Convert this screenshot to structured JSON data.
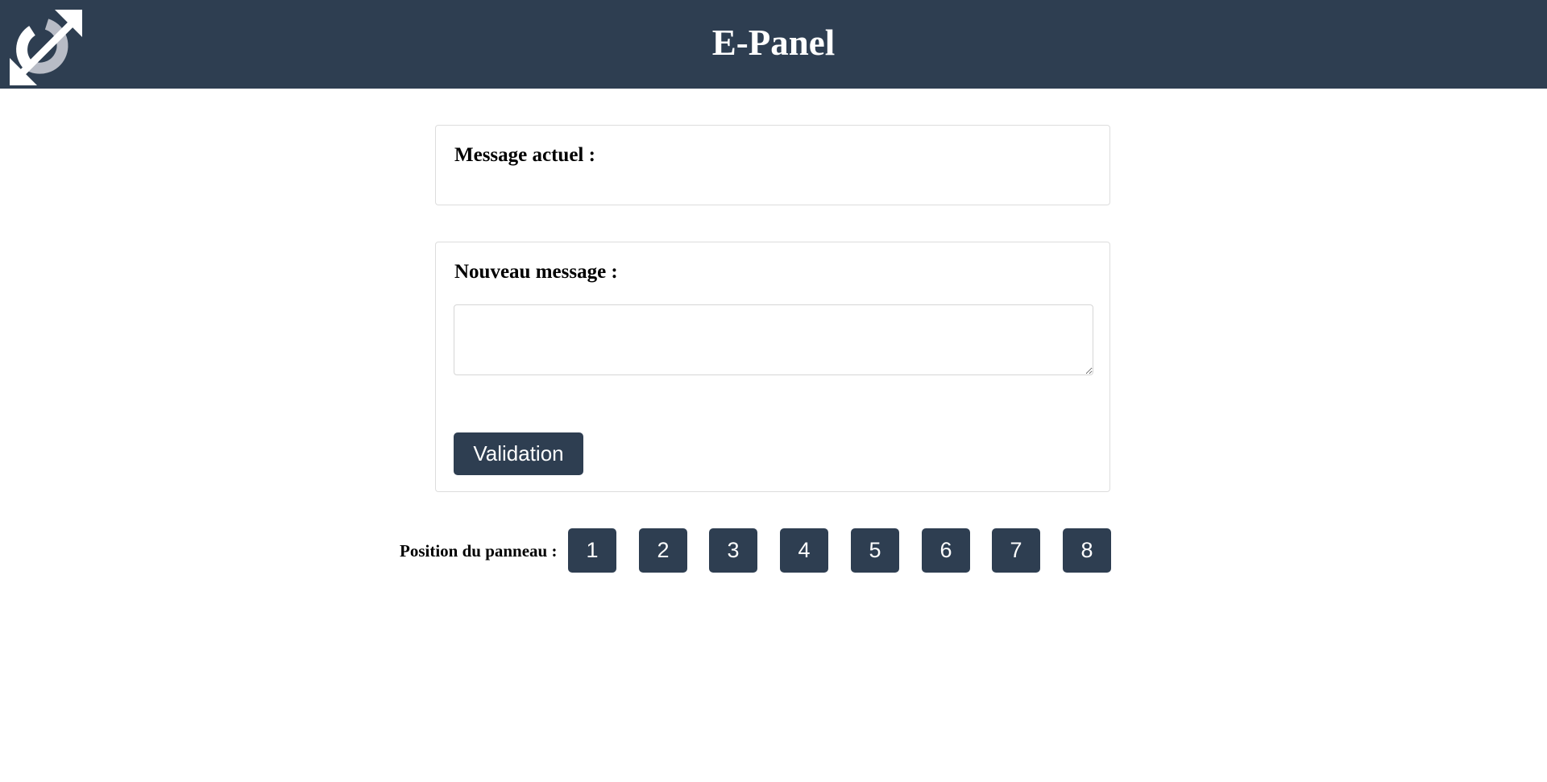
{
  "header": {
    "title": "E-Panel",
    "logo_icon": "bidirectional-arrow-logo-icon",
    "background_color": "#2e3e51"
  },
  "current_message": {
    "heading": "Message actuel :",
    "value": ""
  },
  "new_message": {
    "heading": "Nouveau message :",
    "input_value": "",
    "submit_label": "Validation"
  },
  "position": {
    "label": "Position du panneau :",
    "buttons": [
      "1",
      "2",
      "3",
      "4",
      "5",
      "6",
      "7",
      "8"
    ]
  },
  "colors": {
    "accent": "#2e3e51",
    "logo_shadow": "#b8bcc6"
  }
}
